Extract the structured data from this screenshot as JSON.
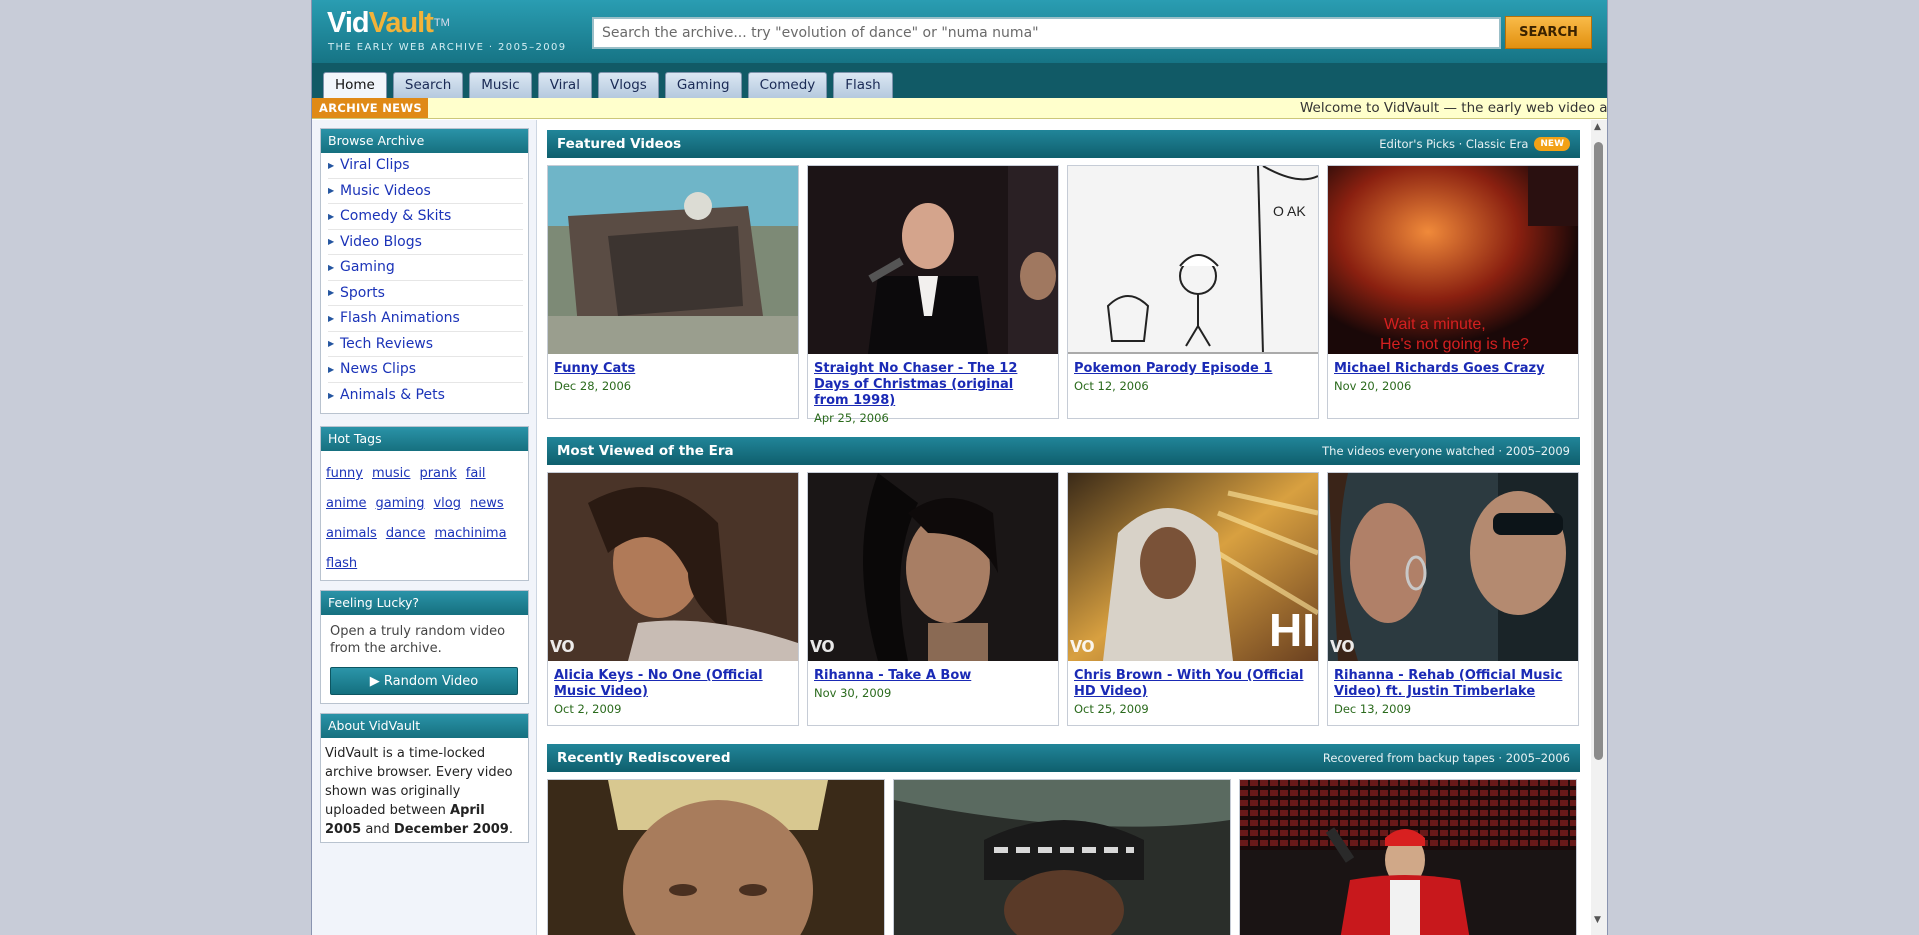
{
  "header": {
    "logo_part1": "Vid",
    "logo_part2": "Vault",
    "logo_tm": "TM",
    "tagline": "THE EARLY WEB ARCHIVE  ·  2005–2009",
    "search_placeholder": "Search the archive... try \"evolution of dance\" or \"numa numa\"",
    "search_button": "SEARCH"
  },
  "tabs": [
    {
      "label": "Home",
      "active": true
    },
    {
      "label": "Search"
    },
    {
      "label": "Music"
    },
    {
      "label": "Viral"
    },
    {
      "label": "Vlogs"
    },
    {
      "label": "Gaming"
    },
    {
      "label": "Comedy"
    },
    {
      "label": "Flash"
    }
  ],
  "news": {
    "label": "ARCHIVE NEWS",
    "text": "Welcome to VidVault — the early web video archive"
  },
  "sidebar": {
    "browse": {
      "title": "Browse Archive",
      "items": [
        "Viral Clips",
        "Music Videos",
        "Comedy & Skits",
        "Video Blogs",
        "Gaming",
        "Sports",
        "Flash Animations",
        "Tech Reviews",
        "News Clips",
        "Animals & Pets"
      ]
    },
    "tags": {
      "title": "Hot Tags",
      "items": [
        "funny",
        "music",
        "prank",
        "fail",
        "anime",
        "gaming",
        "vlog",
        "news",
        "animals",
        "dance",
        "machinima",
        "flash"
      ]
    },
    "lucky": {
      "title": "Feeling Lucky?",
      "text": "Open a truly random video from the archive.",
      "button": "▶ Random Video"
    },
    "about": {
      "title": "About VidVault",
      "text_1": "VidVault is a time-locked archive browser. Every video shown was originally uploaded between ",
      "bold_1": "April 2005",
      "text_2": " and ",
      "bold_2": "December 2009",
      "text_3": "."
    }
  },
  "sections": {
    "featured": {
      "title": "Featured Videos",
      "subtitle": "Editor's Picks · Classic Era",
      "badge": "NEW",
      "videos": [
        {
          "title": "Funny Cats",
          "date": "Dec 28, 2006"
        },
        {
          "title": "Straight No Chaser - The 12 Days of Christmas (original from 1998)",
          "date": "Apr 25, 2006"
        },
        {
          "title": "Pokemon Parody Episode 1",
          "date": "Oct 12, 2006"
        },
        {
          "title": "Michael Richards Goes Crazy",
          "date": "Nov 20, 2006"
        }
      ]
    },
    "most_viewed": {
      "title": "Most Viewed of the Era",
      "subtitle": "The videos everyone watched · 2005–2009",
      "videos": [
        {
          "title": "Alicia Keys - No One (Official Music Video)",
          "date": "Oct 2, 2009"
        },
        {
          "title": "Rihanna - Take A Bow",
          "date": "Nov 30, 2009"
        },
        {
          "title": "Chris Brown - With You (Official HD Video)",
          "date": "Oct 25, 2009"
        },
        {
          "title": "Rihanna - Rehab (Official Music Video) ft. Justin Timberlake",
          "date": "Dec 13, 2009"
        }
      ]
    },
    "recent": {
      "title": "Recently Rediscovered",
      "subtitle": "Recovered from backup tapes · 2005–2006"
    }
  },
  "thumb_overlays": {
    "vevo": "vo",
    "hd": "HI",
    "caption_1": "Wait a minute,",
    "caption_2": "He's not going is he?",
    "pokemon_sign": "O AK"
  }
}
